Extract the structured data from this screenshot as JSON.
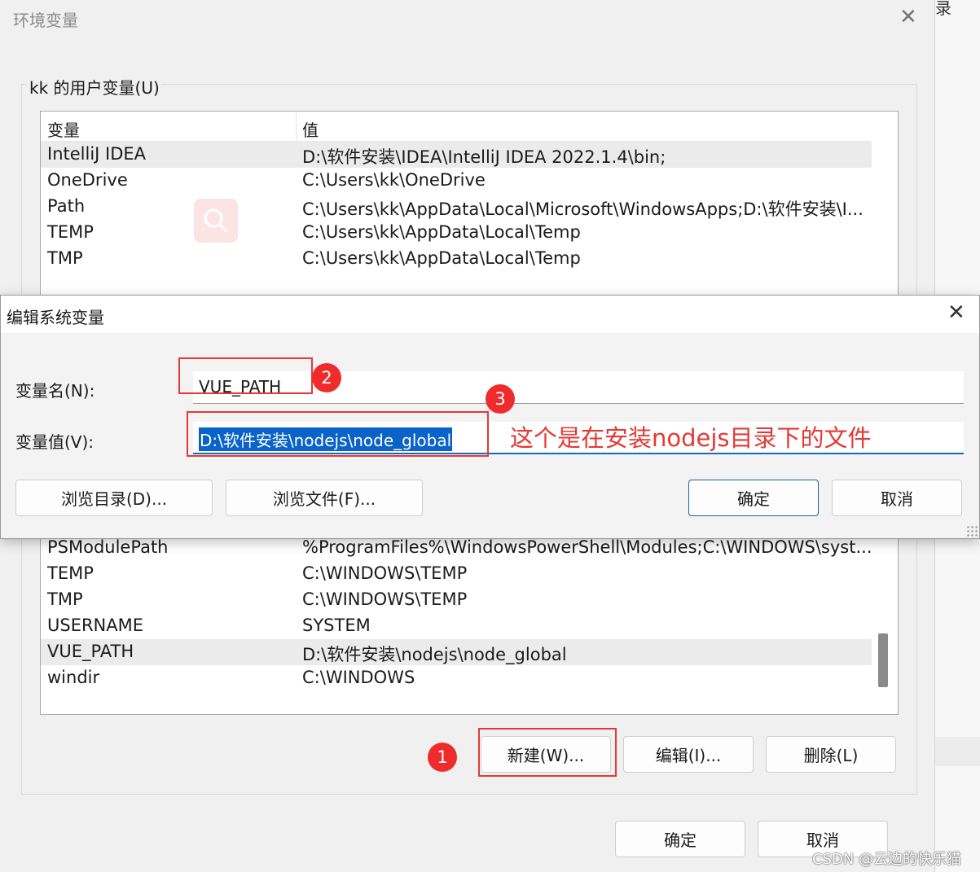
{
  "main_window": {
    "title": "环境变量",
    "user_group_label": "kk 的用户变量(U)",
    "columns": {
      "name": "变量",
      "value": "值"
    },
    "user_vars": [
      {
        "name": "IntelliJ IDEA",
        "value": "D:\\软件安装\\IDEA\\IntelliJ IDEA 2022.1.4\\bin;"
      },
      {
        "name": "OneDrive",
        "value": "C:\\Users\\kk\\OneDrive"
      },
      {
        "name": "Path",
        "value": "C:\\Users\\kk\\AppData\\Local\\Microsoft\\WindowsApps;D:\\软件安装\\I..."
      },
      {
        "name": "TEMP",
        "value": "C:\\Users\\kk\\AppData\\Local\\Temp"
      },
      {
        "name": "TMP",
        "value": "C:\\Users\\kk\\AppData\\Local\\Temp"
      }
    ],
    "system_vars": [
      {
        "name": "PSModulePath",
        "value": "%ProgramFiles%\\WindowsPowerShell\\Modules;C:\\WINDOWS\\syst..."
      },
      {
        "name": "TEMP",
        "value": "C:\\WINDOWS\\TEMP"
      },
      {
        "name": "TMP",
        "value": "C:\\WINDOWS\\TEMP"
      },
      {
        "name": "USERNAME",
        "value": "SYSTEM"
      },
      {
        "name": "VUE_PATH",
        "value": "D:\\软件安装\\nodejs\\node_global"
      },
      {
        "name": "windir",
        "value": "C:\\WINDOWS"
      }
    ],
    "system_buttons": {
      "new": "新建(W)...",
      "edit": "编辑(I)...",
      "delete": "删除(L)"
    },
    "footer_buttons": {
      "ok": "确定",
      "cancel": "取消"
    }
  },
  "edit_dialog": {
    "title": "编辑系统变量",
    "name_label": "变量名(N):",
    "name_value": "VUE_PATH",
    "value_label": "变量值(V):",
    "value_value": "D:\\软件安装\\nodejs\\node_global",
    "buttons": {
      "browse_dir": "浏览目录(D)...",
      "browse_file": "浏览文件(F)...",
      "ok": "确定",
      "cancel": "取消"
    }
  },
  "annotations": {
    "badge_1": "1",
    "badge_2": "2",
    "badge_3": "3",
    "note": "这个是在安装nodejs目录下的文件",
    "accent_color": "#e53935"
  },
  "background": {
    "right_fragment": "录"
  },
  "watermark": "CSDN @云边的快乐猫"
}
